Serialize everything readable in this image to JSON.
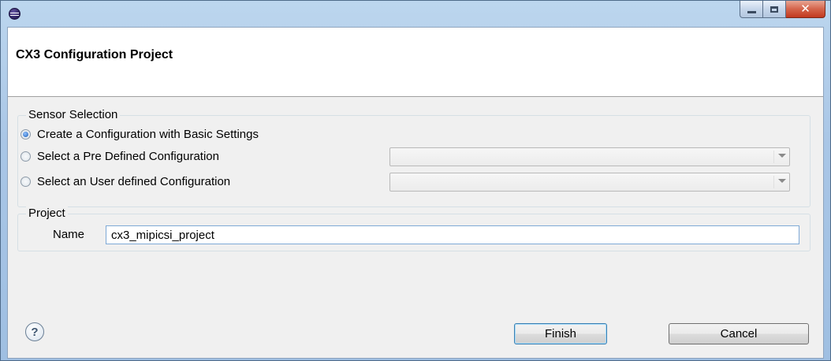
{
  "window": {
    "title": "",
    "header_title": "CX3 Configuration Project"
  },
  "sensor_selection": {
    "label": "Sensor Selection",
    "options": [
      {
        "label": "Create a Configuration with Basic Settings",
        "checked": true
      },
      {
        "label": "Select a Pre Defined Configuration",
        "checked": false
      },
      {
        "label": "Select an User defined Configuration",
        "checked": false
      }
    ],
    "predefined_combo_value": "",
    "user_defined_combo_value": ""
  },
  "project": {
    "label": "Project",
    "name_label": "Name",
    "name_value": "cx3_mipicsi_project"
  },
  "buttons": {
    "help": "?",
    "finish": "Finish",
    "cancel": "Cancel"
  },
  "icons": {
    "app": "eclipse-icon",
    "minimize": "minimize-icon",
    "maximize": "maximize-icon",
    "close": "close-icon",
    "help": "help-icon",
    "dropdown": "chevron-down-icon"
  }
}
